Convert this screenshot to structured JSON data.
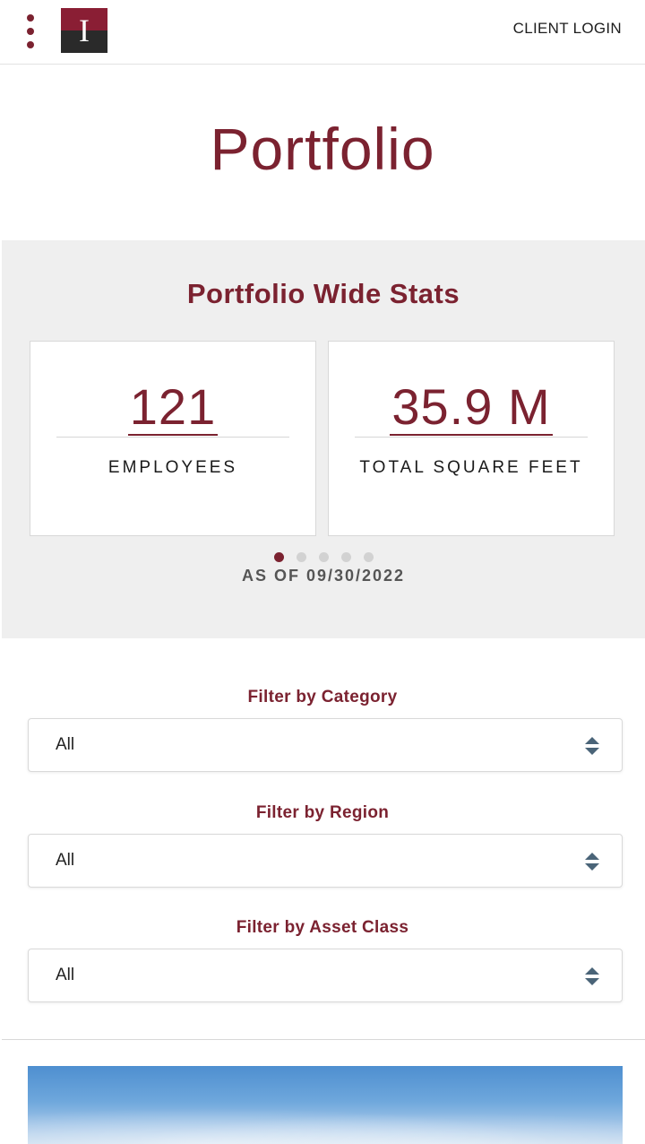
{
  "header": {
    "logo_letter": "I",
    "client_login": "CLIENT LOGIN"
  },
  "page": {
    "title": "Portfolio"
  },
  "stats": {
    "heading": "Portfolio Wide Stats",
    "cards": [
      {
        "value": "121",
        "label": "EMPLOYEES"
      },
      {
        "value": "35.9 M",
        "label": "TOTAL SQUARE FEET"
      }
    ],
    "carousel_pages": 5,
    "active_page": 1,
    "as_of": "AS OF 09/30/2022"
  },
  "filters": [
    {
      "label": "Filter by Category",
      "value": "All"
    },
    {
      "label": "Filter by Region",
      "value": "All"
    },
    {
      "label": "Filter by Asset Class",
      "value": "All"
    }
  ],
  "colors": {
    "brand": "#7b2230",
    "stats_background": "#efefef",
    "select_arrow": "#4a6478"
  },
  "icons": {
    "menu": "vertical-dots-icon",
    "select": "up-down-arrows-icon"
  }
}
